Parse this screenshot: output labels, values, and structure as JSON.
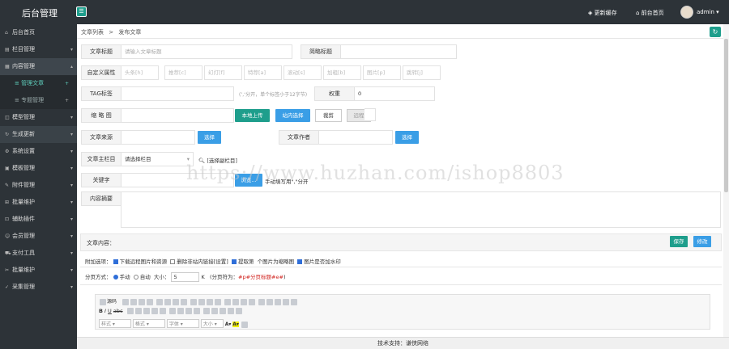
{
  "header": {
    "brand": "后台管理",
    "toggle_icon": "menu-toggle-icon",
    "update_cache": "更新缓存",
    "frontend_home": "前台首页",
    "user": "admin",
    "user_caret": "▾"
  },
  "sidebar": {
    "items": [
      {
        "label": "后台首页",
        "icon": "home-icon"
      },
      {
        "label": "栏目管理",
        "icon": "list-icon",
        "arrow": "▾"
      },
      {
        "label": "内容管理",
        "icon": "file-icon",
        "arrow": "▴"
      },
      {
        "label": "管理文章",
        "sub": true,
        "plus": "+"
      },
      {
        "label": "专题管理",
        "sub": true,
        "plus": "+"
      },
      {
        "label": "模型管理",
        "icon": "cube-icon",
        "arrow": "▾"
      },
      {
        "label": "生成更新",
        "icon": "refresh-icon",
        "arrow": "▾"
      },
      {
        "label": "系统设置",
        "icon": "gear-icon",
        "arrow": "▾"
      },
      {
        "label": "模板管理",
        "icon": "template-icon",
        "arrow": "▾"
      },
      {
        "label": "附件管理",
        "icon": "attachment-icon",
        "arrow": "▾"
      },
      {
        "label": "批量维护",
        "icon": "batch-icon",
        "arrow": "▾"
      },
      {
        "label": "辅助插件",
        "icon": "plugin-icon",
        "arrow": "▾"
      },
      {
        "label": "会员管理",
        "icon": "user-icon",
        "arrow": "▾"
      },
      {
        "label": "支付工具",
        "icon": "pay-icon",
        "arrow": "▾"
      },
      {
        "label": "批量维护",
        "icon": "tool-icon",
        "arrow": "▾"
      },
      {
        "label": "采集管理",
        "icon": "collect-icon",
        "arrow": "▾"
      }
    ]
  },
  "breadcrumb": {
    "a": "文章列表",
    "sep": ">",
    "b": "发布文章"
  },
  "form": {
    "title_label": "文章标题",
    "title_placeholder": "请输入文章标题",
    "short_title_label": "简略标题",
    "attr_label": "自定义属性",
    "attrs": [
      "头条[h]",
      "推荐[c]",
      "幻灯[f]",
      "特荐[a]",
      "滚动[s]",
      "加粗[b]",
      "图片[p]",
      "跳转[j]"
    ],
    "tag_label": "TAG标签",
    "tag_hint": "(’,‘分开，单个标签小于12字节)",
    "weight_label": "权重",
    "weight_value": "0",
    "thumb_label": "缩 略 图",
    "upload_btn": "本地上传",
    "site_select_btn": "站内选择",
    "crop_btn": "裁剪",
    "remote_label": "远程",
    "source_label": "文章来源",
    "source_select": "选择",
    "author_label": "文章作者",
    "author_select": "选择",
    "column_label": "文章主栏目",
    "column_value": "请选择栏目",
    "column_link": "[选择副栏目]",
    "keyword_label": "关键字",
    "keyword_btn": "浏览...",
    "keyword_hint": "手动填写用\",\"分开",
    "summary_label": "内容摘要"
  },
  "content": {
    "label": "文章内容：",
    "btn_a": "保存",
    "btn_b": "修改",
    "options_label": "附加选项：",
    "opt1": "下载远程图片和资源",
    "opt2": "删除非站内链接",
    "opt2_link": "[设置]",
    "opt3": "提取第",
    "opt3_b": "个图片为缩略图",
    "opt4": "图片是否加水印",
    "page_label": "分页方式：",
    "page_manual": "手动",
    "page_auto": "自动",
    "size_label": "大小：",
    "size_value": "5",
    "size_unit": "K",
    "page_sep_hint": "(分页符为：",
    "page_sep_code": "#p#分页标题#e#",
    "page_sep_end": ")",
    "editor_source": "源码",
    "fmt_a": "样式",
    "fmt_b": "格式",
    "fmt_c": "字体",
    "fmt_d": "大小"
  },
  "watermark": "https://www.huzhan.com/ishop8803",
  "footer": "技术支持：谦侠网络",
  "colors": {
    "teal": "#1e9e8c",
    "blue": "#3a9ee6",
    "dark": "#2d3338"
  }
}
